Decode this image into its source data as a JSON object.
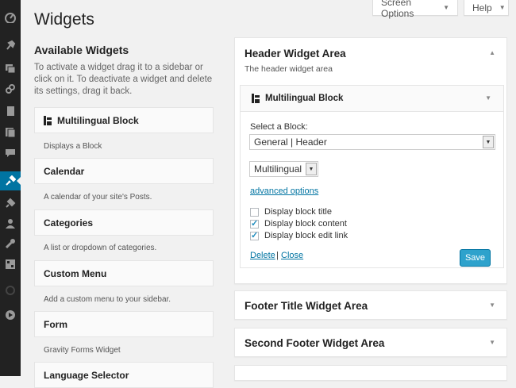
{
  "page": {
    "title": "Widgets"
  },
  "header_buttons": {
    "screen_options": "Screen Options",
    "help": "Help"
  },
  "available": {
    "title": "Available Widgets",
    "description": "To activate a widget drag it to a sidebar or click on it. To deactivate a widget and delete its settings, drag it back.",
    "widgets": [
      {
        "name": "Multilingual Block",
        "desc": "Displays a Block"
      },
      {
        "name": "Calendar",
        "desc": "A calendar of your site's Posts."
      },
      {
        "name": "Categories",
        "desc": "A list or dropdown of categories."
      },
      {
        "name": "Custom Menu",
        "desc": "Add a custom menu to your sidebar."
      },
      {
        "name": "Form",
        "desc": "Gravity Forms Widget"
      },
      {
        "name": "Language Selector",
        "desc": ""
      }
    ]
  },
  "header_area": {
    "title": "Header Widget Area",
    "desc": "The header widget area",
    "widget": {
      "title": "Multilingual Block",
      "select_label": "Select a Block:",
      "block_value": "General | Header",
      "lang_value": "Multilingual",
      "advanced": "advanced options",
      "checkboxes": [
        {
          "label": "Display block title",
          "checked": false
        },
        {
          "label": "Display block content",
          "checked": true
        },
        {
          "label": "Display block edit link",
          "checked": true
        }
      ],
      "delete": "Delete",
      "sep": "|",
      "close": "Close",
      "save": "Save"
    }
  },
  "other_areas": [
    {
      "title": "Footer Title Widget Area"
    },
    {
      "title": "Second Footer Widget Area"
    }
  ],
  "adminbar_icons": [
    "dashboard-icon",
    "pin-icon",
    "media-icon",
    "links-icon",
    "pages-icon",
    "comments-icon",
    "feedback-icon",
    "appearance-icon",
    "plugins-icon",
    "users-icon",
    "tools-icon",
    "settings-icon",
    "spinner-icon",
    "play-icon"
  ],
  "colors": {
    "accent": "#0074a2",
    "button": "#2ea2cc",
    "adminbar": "#222222"
  }
}
